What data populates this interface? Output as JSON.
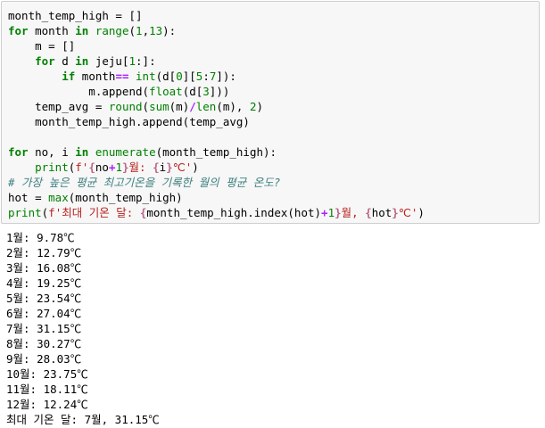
{
  "code": {
    "lines": [
      [
        {
          "t": "month_temp_high = []",
          "c": ""
        }
      ],
      [
        {
          "t": "for",
          "c": "kw"
        },
        {
          "t": " month ",
          "c": ""
        },
        {
          "t": "in",
          "c": "kw"
        },
        {
          "t": " ",
          "c": ""
        },
        {
          "t": "range",
          "c": "bi"
        },
        {
          "t": "(",
          "c": ""
        },
        {
          "t": "1",
          "c": "num"
        },
        {
          "t": ",",
          "c": ""
        },
        {
          "t": "13",
          "c": "num"
        },
        {
          "t": "):",
          "c": ""
        }
      ],
      [
        {
          "t": "    m = []",
          "c": ""
        }
      ],
      [
        {
          "t": "    ",
          "c": ""
        },
        {
          "t": "for",
          "c": "kw"
        },
        {
          "t": " d ",
          "c": ""
        },
        {
          "t": "in",
          "c": "kw"
        },
        {
          "t": " jeju[",
          "c": ""
        },
        {
          "t": "1",
          "c": "num"
        },
        {
          "t": ":]:",
          "c": ""
        }
      ],
      [
        {
          "t": "        ",
          "c": ""
        },
        {
          "t": "if",
          "c": "kw"
        },
        {
          "t": " month",
          "c": ""
        },
        {
          "t": "==",
          "c": "op"
        },
        {
          "t": " ",
          "c": ""
        },
        {
          "t": "int",
          "c": "bi"
        },
        {
          "t": "(d[",
          "c": ""
        },
        {
          "t": "0",
          "c": "num"
        },
        {
          "t": "][",
          "c": ""
        },
        {
          "t": "5",
          "c": "num"
        },
        {
          "t": ":",
          "c": ""
        },
        {
          "t": "7",
          "c": "num"
        },
        {
          "t": "]):",
          "c": ""
        }
      ],
      [
        {
          "t": "            m.append(",
          "c": ""
        },
        {
          "t": "float",
          "c": "bi"
        },
        {
          "t": "(d[",
          "c": ""
        },
        {
          "t": "3",
          "c": "num"
        },
        {
          "t": "]))",
          "c": ""
        }
      ],
      [
        {
          "t": "    temp_avg = ",
          "c": ""
        },
        {
          "t": "round",
          "c": "bi"
        },
        {
          "t": "(",
          "c": ""
        },
        {
          "t": "sum",
          "c": "bi"
        },
        {
          "t": "(m)",
          "c": ""
        },
        {
          "t": "/",
          "c": "op"
        },
        {
          "t": "len",
          "c": "bi"
        },
        {
          "t": "(m), ",
          "c": ""
        },
        {
          "t": "2",
          "c": "num"
        },
        {
          "t": ")",
          "c": ""
        }
      ],
      [
        {
          "t": "    month_temp_high.append(temp_avg)",
          "c": ""
        }
      ],
      [
        {
          "t": "",
          "c": ""
        }
      ],
      [
        {
          "t": "for",
          "c": "kw"
        },
        {
          "t": " no, i ",
          "c": ""
        },
        {
          "t": "in",
          "c": "kw"
        },
        {
          "t": " ",
          "c": ""
        },
        {
          "t": "enumerate",
          "c": "bi"
        },
        {
          "t": "(month_temp_high):",
          "c": ""
        }
      ],
      [
        {
          "t": "    ",
          "c": ""
        },
        {
          "t": "print",
          "c": "bi"
        },
        {
          "t": "(",
          "c": ""
        },
        {
          "t": "f'",
          "c": "str"
        },
        {
          "t": "{",
          "c": "sp"
        },
        {
          "t": "no",
          "c": ""
        },
        {
          "t": "+",
          "c": "op"
        },
        {
          "t": "1",
          "c": "num"
        },
        {
          "t": "}",
          "c": "sp"
        },
        {
          "t": "월: ",
          "c": "str"
        },
        {
          "t": "{",
          "c": "sp"
        },
        {
          "t": "i",
          "c": ""
        },
        {
          "t": "}",
          "c": "sp"
        },
        {
          "t": "℃'",
          "c": "str"
        },
        {
          "t": ")",
          "c": ""
        }
      ],
      [
        {
          "t": "# 가장 높은 평균 최고기온을 기록한 월의 평균 온도?",
          "c": "cm"
        }
      ],
      [
        {
          "t": "hot = ",
          "c": ""
        },
        {
          "t": "max",
          "c": "bi"
        },
        {
          "t": "(month_temp_high)",
          "c": ""
        }
      ],
      [
        {
          "t": "print",
          "c": "bi"
        },
        {
          "t": "(",
          "c": ""
        },
        {
          "t": "f'최대 기온 달: ",
          "c": "str"
        },
        {
          "t": "{",
          "c": "sp"
        },
        {
          "t": "month_temp_high.index(hot)",
          "c": ""
        },
        {
          "t": "+",
          "c": "op"
        },
        {
          "t": "1",
          "c": "num"
        },
        {
          "t": "}",
          "c": "sp"
        },
        {
          "t": "월, ",
          "c": "str"
        },
        {
          "t": "{",
          "c": "sp"
        },
        {
          "t": "hot",
          "c": ""
        },
        {
          "t": "}",
          "c": "sp"
        },
        {
          "t": "℃'",
          "c": "str"
        },
        {
          "t": ")",
          "c": ""
        }
      ]
    ]
  },
  "output": {
    "lines": [
      "1월: 9.78℃",
      "2월: 12.79℃",
      "3월: 16.08℃",
      "4월: 19.25℃",
      "5월: 23.54℃",
      "6월: 27.04℃",
      "7월: 31.15℃",
      "8월: 30.27℃",
      "9월: 28.03℃",
      "10월: 23.75℃",
      "11월: 18.11℃",
      "12월: 12.24℃",
      "최대 기온 달: 7월, 31.15℃"
    ]
  }
}
